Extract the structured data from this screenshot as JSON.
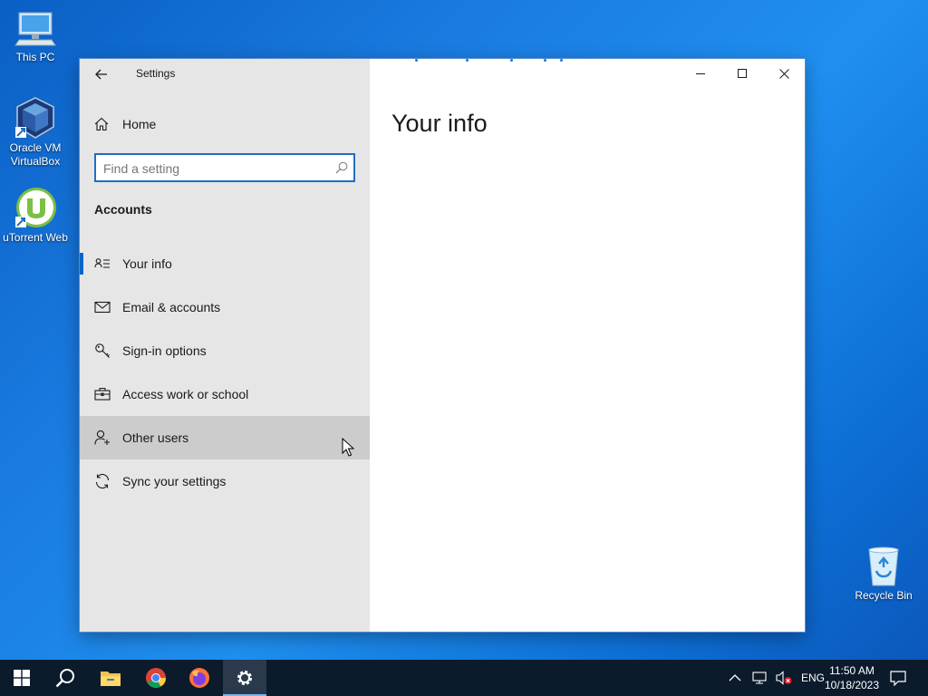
{
  "desktop": {
    "icons": [
      {
        "label": "This PC",
        "icon": "computer-icon"
      },
      {
        "label": "Oracle VM VirtualBox",
        "icon": "virtualbox-icon"
      },
      {
        "label": "uTorrent Web",
        "icon": "utorrent-icon"
      },
      {
        "label": "Recycle Bin",
        "icon": "recycle-bin-icon"
      }
    ]
  },
  "window": {
    "app_title": "Settings",
    "home_label": "Home",
    "search": {
      "placeholder": "Find a setting",
      "value": ""
    },
    "section_heading": "Accounts",
    "nav_items": [
      {
        "label": "Your info",
        "icon": "person-card-icon",
        "selected": true
      },
      {
        "label": "Email & accounts",
        "icon": "mail-icon"
      },
      {
        "label": "Sign-in options",
        "icon": "key-icon"
      },
      {
        "label": "Access work or school",
        "icon": "briefcase-icon"
      },
      {
        "label": "Other users",
        "icon": "add-person-icon",
        "hover": true
      },
      {
        "label": "Sync your settings",
        "icon": "sync-icon"
      }
    ],
    "page_title": "Your info",
    "controls": [
      "minimize",
      "maximize",
      "close"
    ]
  },
  "taskbar": {
    "apps": [
      "start",
      "search",
      "file-explorer",
      "chrome",
      "firefox",
      "settings"
    ],
    "active_app": "settings",
    "tray": {
      "language": "ENG"
    },
    "clock": {
      "time": "11:50 AM",
      "date": "10/18/2023"
    }
  },
  "colors": {
    "accent": "#0a64c8",
    "sidebar_bg": "#e6e6e6",
    "hover_bg": "#cccccc",
    "taskbar_bg": "#0c1b2b"
  }
}
